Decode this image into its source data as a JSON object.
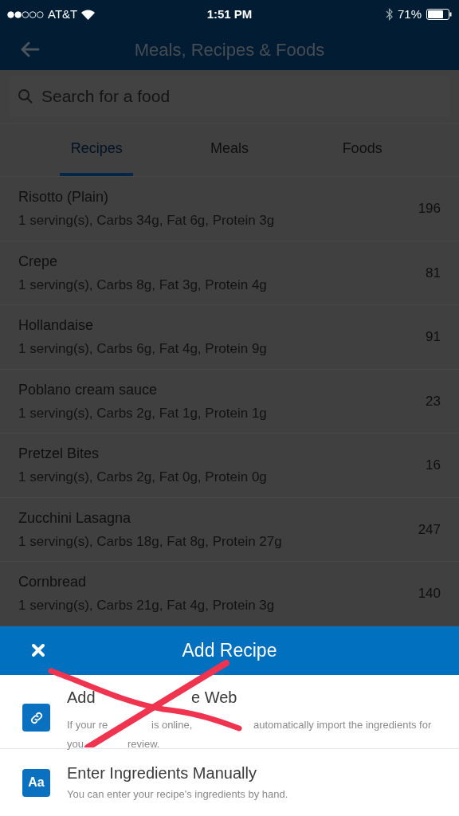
{
  "status_bar": {
    "carrier": "AT&T",
    "time": "1:51 PM",
    "battery": "71%"
  },
  "header": {
    "title": "Meals, Recipes & Foods"
  },
  "search": {
    "placeholder": "Search for a food"
  },
  "tabs": [
    {
      "label": "Recipes",
      "selected": true
    },
    {
      "label": "Meals",
      "selected": false
    },
    {
      "label": "Foods",
      "selected": false
    }
  ],
  "recipes": [
    {
      "name": "Risotto (Plain)",
      "details": "1 serving(s), Carbs 34g, Fat 6g, Protein 3g",
      "calories": "196"
    },
    {
      "name": "Crepe",
      "details": "1 serving(s), Carbs 8g, Fat 3g, Protein 4g",
      "calories": "81"
    },
    {
      "name": "Hollandaise",
      "details": "1 serving(s), Carbs 6g, Fat 4g, Protein 9g",
      "calories": "91"
    },
    {
      "name": "Poblano cream sauce",
      "details": "1 serving(s), Carbs 2g, Fat 1g, Protein 1g",
      "calories": "23"
    },
    {
      "name": "Pretzel Bites",
      "details": "1 serving(s), Carbs 2g, Fat 0g, Protein 0g",
      "calories": "16"
    },
    {
      "name": "Zucchini Lasagna",
      "details": "1 serving(s), Carbs 18g, Fat 8g, Protein 27g",
      "calories": "247"
    },
    {
      "name": "Cornbread",
      "details": "1 serving(s), Carbs 21g, Fat 4g, Protein 3g",
      "calories": "140"
    }
  ],
  "sheet": {
    "title": "Add Recipe",
    "options": [
      {
        "kind": "link",
        "title_parts": [
          "Add",
          "e Web"
        ],
        "description_lines": [
          [
            "If your re",
            "is online,",
            "automatically import the ingredients for"
          ],
          [
            "you",
            "review."
          ]
        ],
        "crossed_out": true
      },
      {
        "kind": "text",
        "icon_text": "Aa",
        "title_parts": [
          "Enter Ingredients Manually"
        ],
        "description_lines": [
          [
            "You can enter your recipe's ingredients by hand."
          ]
        ],
        "crossed_out": false
      }
    ]
  }
}
